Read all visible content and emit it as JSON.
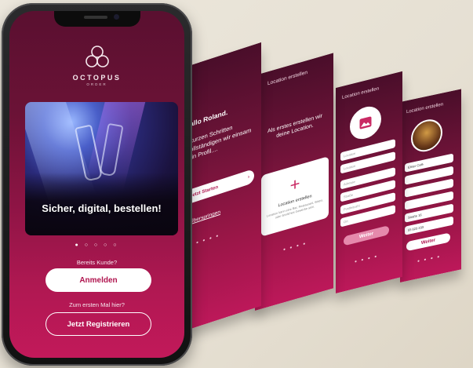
{
  "colors": {
    "brand": "#b0154f",
    "background": "#ece7dc"
  },
  "main_screen": {
    "brand_name": "OCTOPUS",
    "brand_sub": "ORDER",
    "hero_caption": "Sicher, digital, bestellen!",
    "pager_dots": "● ○ ○ ○ ○",
    "existing_customer_label": "Bereits Kunde?",
    "login_button": "Anmelden",
    "first_time_label": "Zum ersten Mal hier?",
    "register_button": "Jetzt Registrieren"
  },
  "screen_welcome": {
    "greeting": "Hallo Roland.",
    "intro": "4 kurzen Schritten rvollständigen wir einsam dein Profil....",
    "start_button": "Jetzt Starten",
    "skip_link": "Überspringen",
    "pager_dots": "● ● ● ●"
  },
  "screen_location": {
    "header": "Location erstellen",
    "intro": "Als erstes erstellen wir deine Location.",
    "card_title": "Location erstellen",
    "card_text": "Location kann eine Bar, Restaurant, Bistro, oder ähnliches Gewerbe sein.",
    "pager_dots": "● ● ● ●"
  },
  "screen_location_form": {
    "header": "Location erstellen",
    "fields": [
      "Location",
      "Location",
      "Adresse",
      "Straße",
      "Postleitzahl",
      "Ort"
    ],
    "next_button": "Weiter",
    "pager_dots": "● ● ● ●"
  },
  "screen_location_filled": {
    "header": "Location erstellen",
    "fields": [
      "Elster Café",
      "",
      "",
      "",
      "Straße 16",
      "",
      "",
      "55 623 233"
    ],
    "next_button": "Weiter",
    "pager_dots": "● ● ● ●"
  }
}
